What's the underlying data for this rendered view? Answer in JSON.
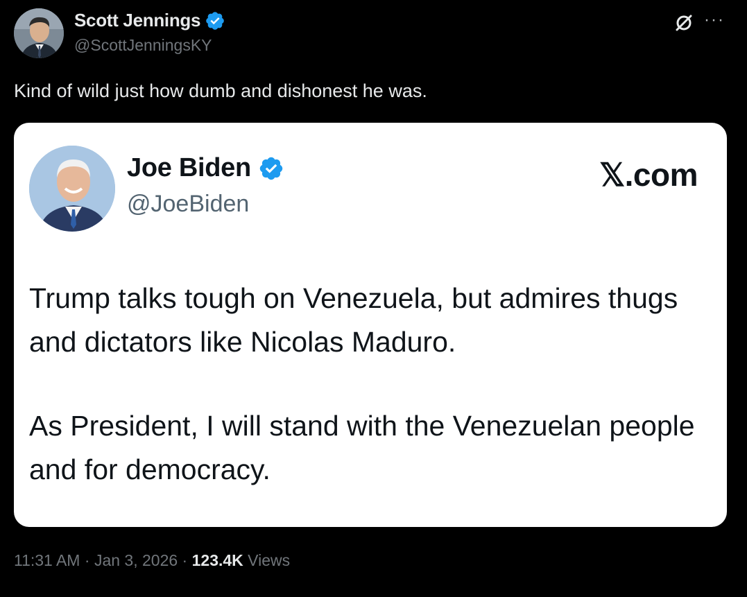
{
  "post": {
    "author_name": "Scott Jennings",
    "author_handle": "@ScottJenningsKY",
    "text": "Kind of wild just how dumb and dishonest he was.",
    "time": "11:31 AM",
    "date": "Jan 3, 2026",
    "separator": "·",
    "views_count": "123.4K",
    "views_label": "Views",
    "more_label": "···"
  },
  "quote": {
    "author_name": "Joe Biden",
    "author_handle": "@JoeBiden",
    "brand": "𝕏.com",
    "paragraph_1": "Trump talks tough on Venezuela, but admires thugs and dictators like Nicolas Maduro.",
    "paragraph_2": "As President, I will stand with the Venezuelan people and for democracy."
  },
  "colors": {
    "background": "#000000",
    "verified_blue": "#1d9bf0",
    "card_background": "#ffffff",
    "secondary_text": "#71767b"
  },
  "icons": {
    "verified": "verified-badge-icon",
    "grok": "grok-icon",
    "more": "more-icon"
  }
}
